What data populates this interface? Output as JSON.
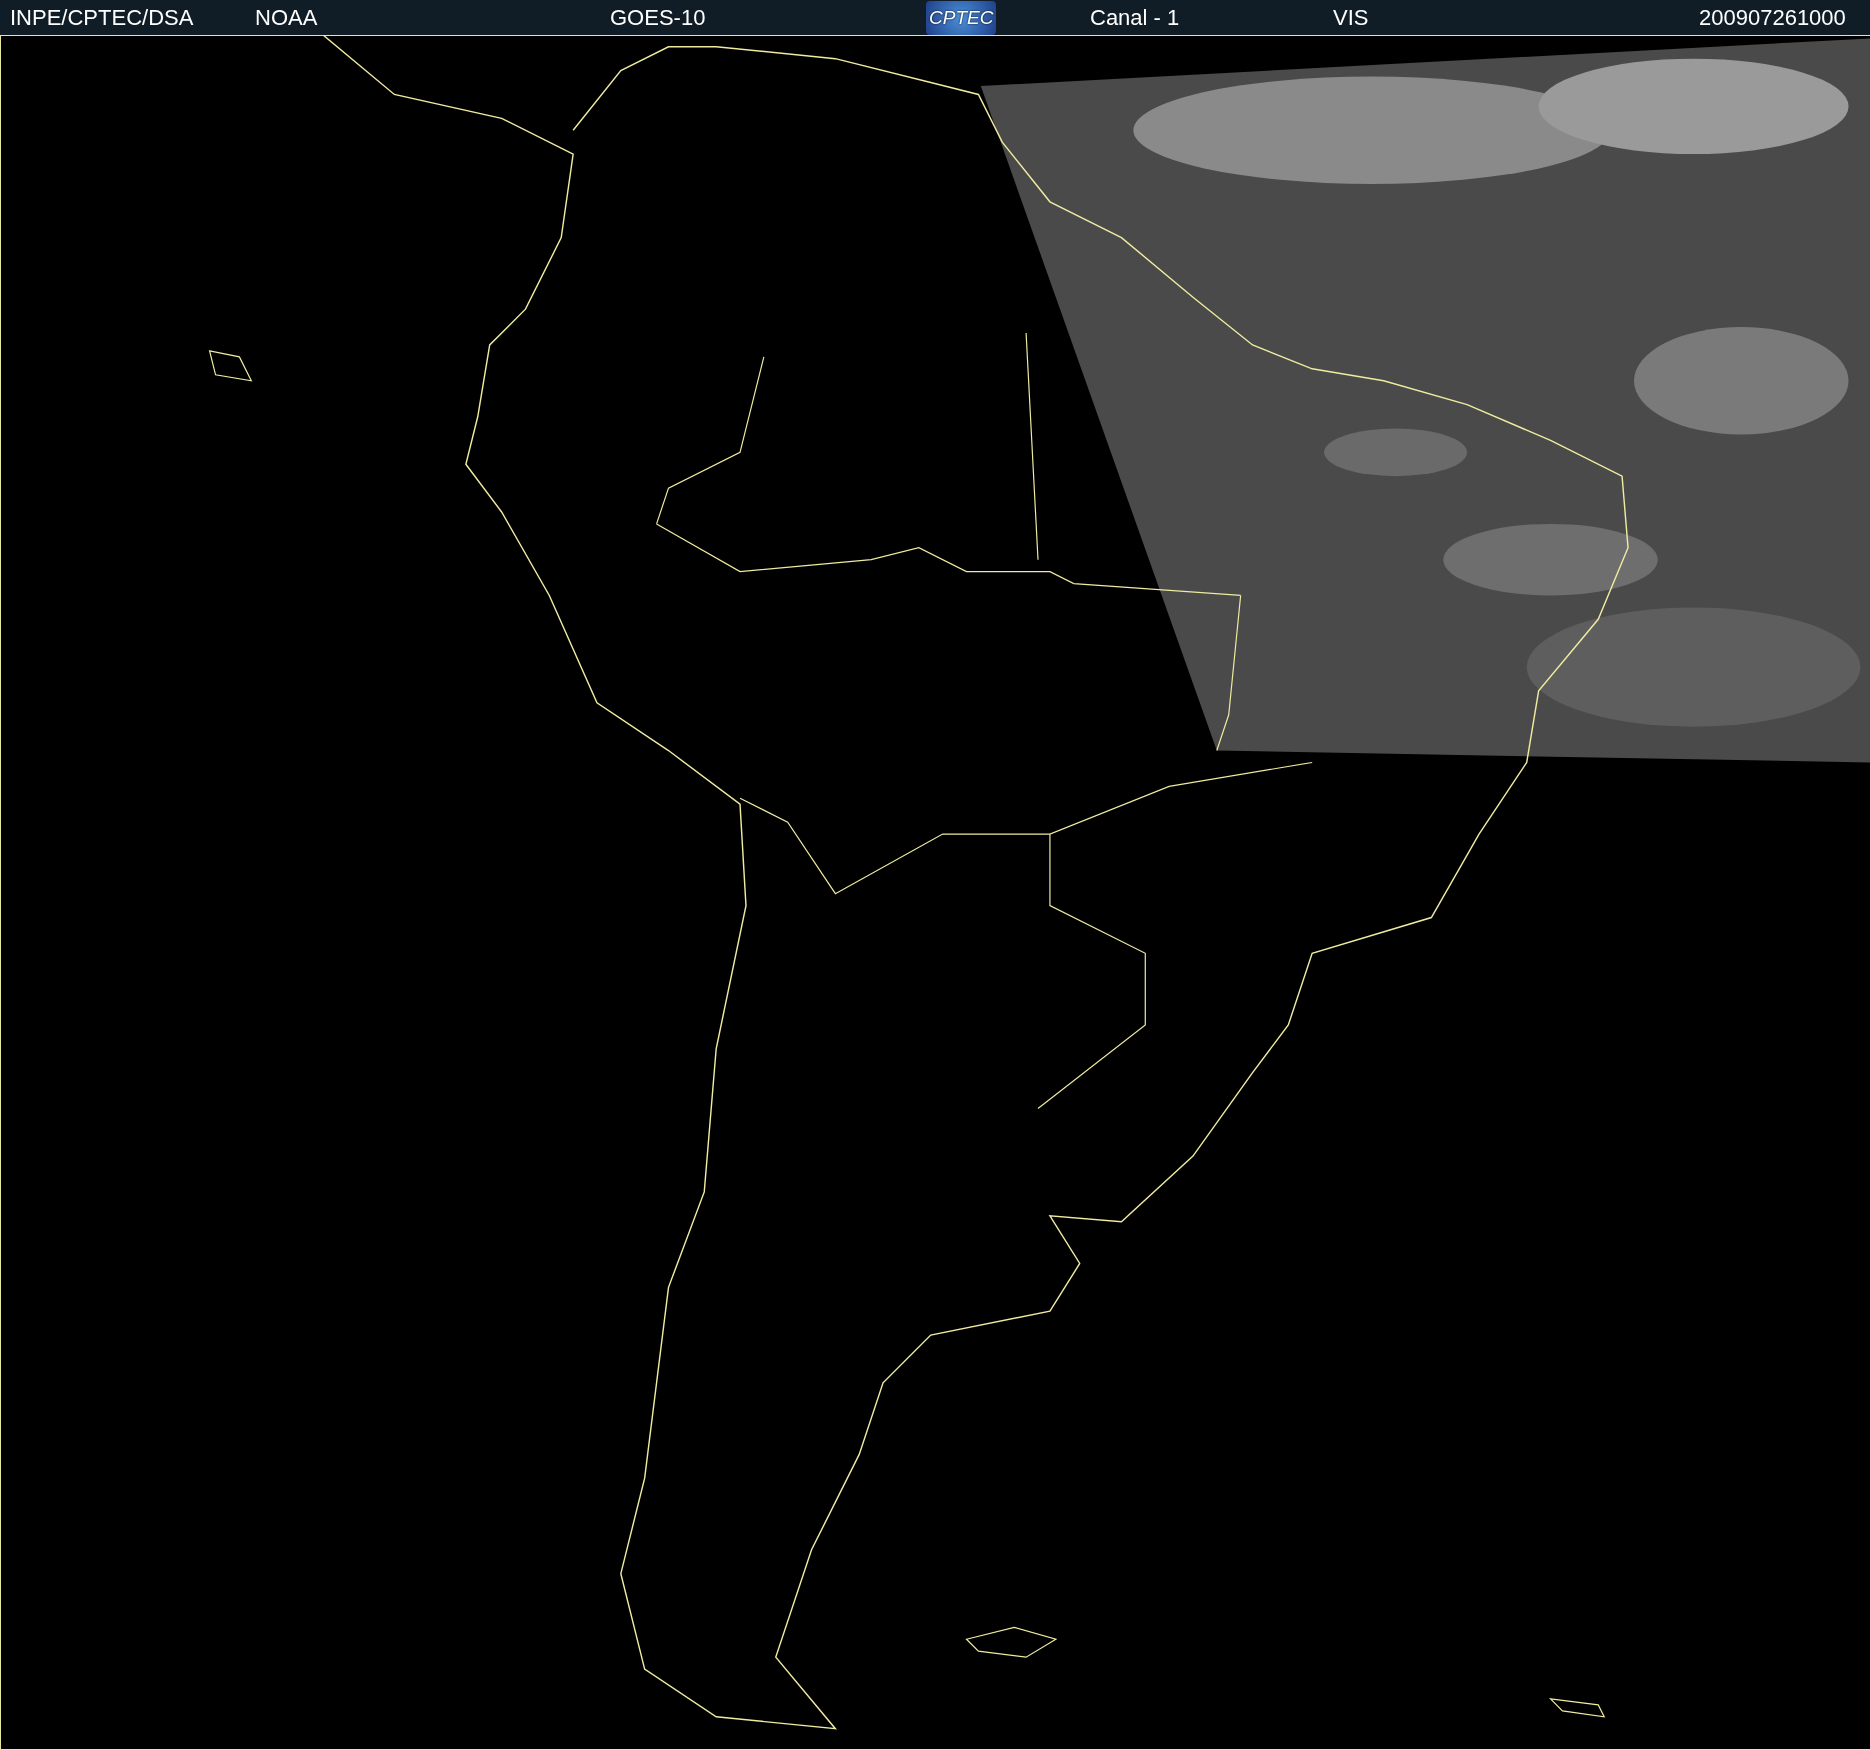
{
  "header": {
    "items": [
      {
        "kind": "text",
        "text": "INPE/CPTEC/DSA"
      },
      {
        "kind": "text",
        "text": "NOAA"
      },
      {
        "kind": "text",
        "text": "GOES-10"
      },
      {
        "kind": "logo",
        "text": "CPTEC"
      },
      {
        "kind": "text",
        "text": "Canal - 1"
      },
      {
        "kind": "text",
        "text": "VIS"
      },
      {
        "kind": "text",
        "text": "200907261000"
      }
    ]
  }
}
